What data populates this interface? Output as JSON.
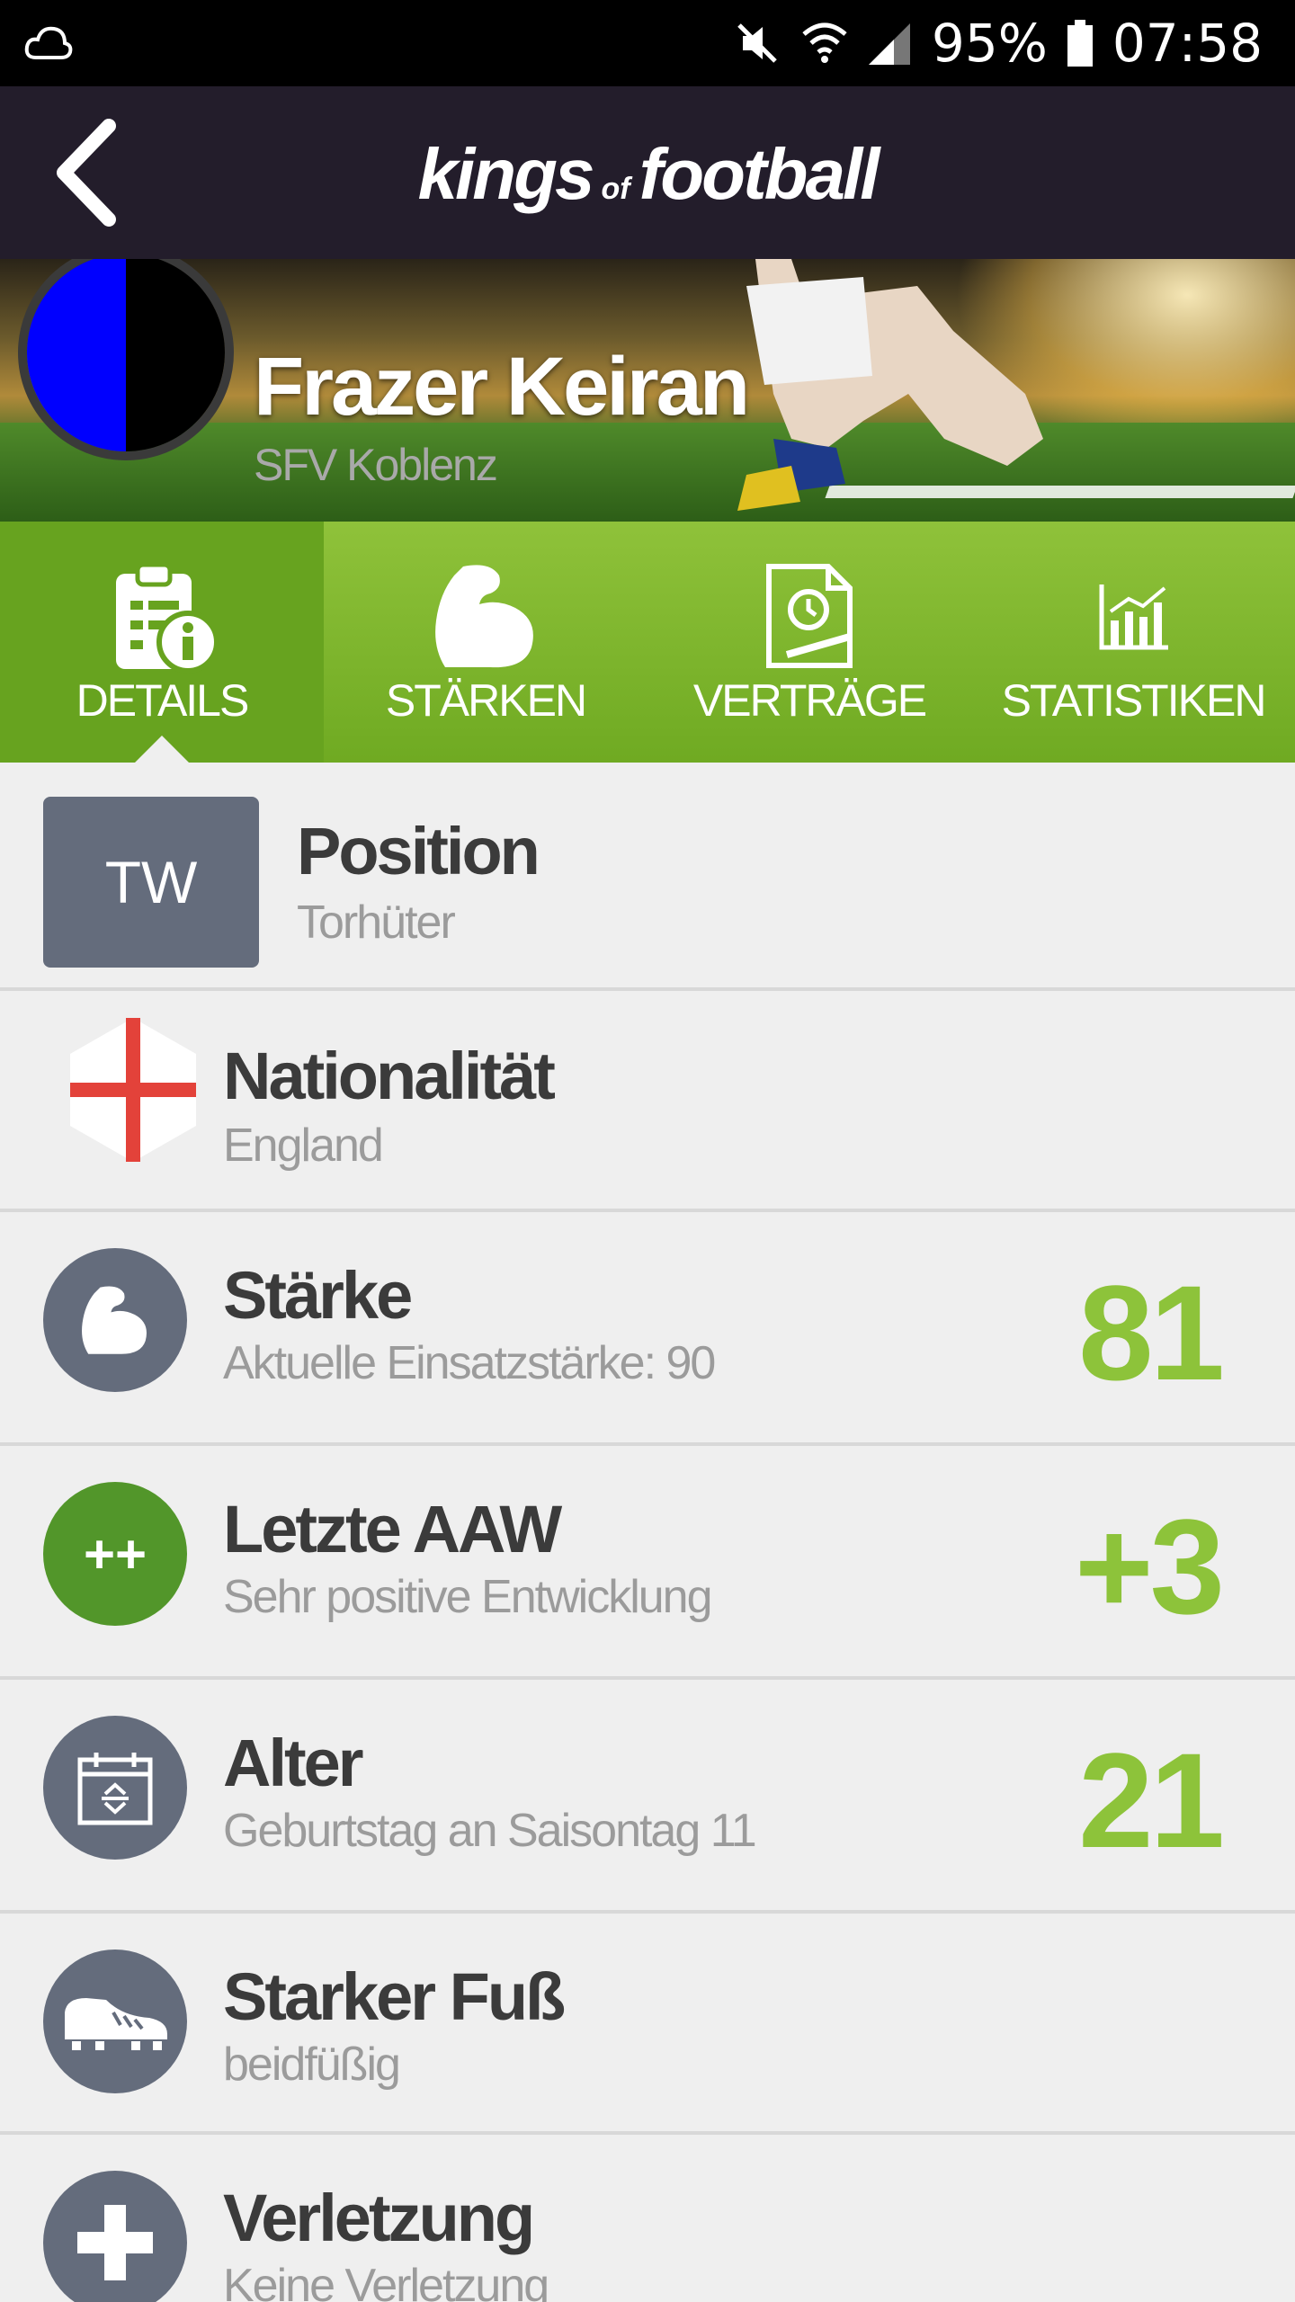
{
  "status_bar": {
    "battery": "95%",
    "time": "07:58",
    "icons": [
      "cloud-icon",
      "mute-icon",
      "wifi-icon",
      "signal-icon",
      "battery-icon"
    ]
  },
  "app_bar": {
    "logo_left": "kings",
    "logo_of": "of",
    "logo_right": "football",
    "back_icon": "chevron-left-icon"
  },
  "player": {
    "name": "Frazer Keiran",
    "club": "SFV Koblenz",
    "crest_colors": [
      "#0000ff",
      "#000000"
    ]
  },
  "tabs": [
    {
      "label": "DETAILS",
      "icon": "clipboard-info-icon",
      "active": true
    },
    {
      "label": "STÄRKEN",
      "icon": "muscle-arm-icon",
      "active": false
    },
    {
      "label": "VERTRÄGE",
      "icon": "contract-icon",
      "active": false
    },
    {
      "label": "STATISTIKEN",
      "icon": "bar-chart-icon",
      "active": false
    }
  ],
  "details": {
    "position": {
      "badge": "TW",
      "title": "Position",
      "subtitle": "Torhüter"
    },
    "nationality": {
      "title": "Nationalität",
      "subtitle": "England",
      "icon": "england-flag-icon"
    },
    "strength": {
      "title": "Stärke",
      "subtitle": "Aktuelle Einsatzstärke: 90",
      "value": "81",
      "icon": "muscle-arm-icon"
    },
    "last_aaw": {
      "title": "Letzte AAW",
      "subtitle": "Sehr positive Entwicklung",
      "value": "+3",
      "icon_text": "++"
    },
    "age": {
      "title": "Alter",
      "subtitle": "Geburtstag an Saisontag 11",
      "value": "21",
      "icon": "calendar-icon"
    },
    "foot": {
      "title": "Starker Fuß",
      "subtitle": "beidfüßig",
      "icon": "football-boot-icon"
    },
    "injury": {
      "title": "Verletzung",
      "subtitle": "Keine Verletzung",
      "icon": "medical-cross-icon"
    }
  },
  "colors": {
    "app_bar": "#231d2b",
    "accent_green": "#8dc33a",
    "icon_gray": "#646c7c",
    "positive_green": "#52962a"
  }
}
